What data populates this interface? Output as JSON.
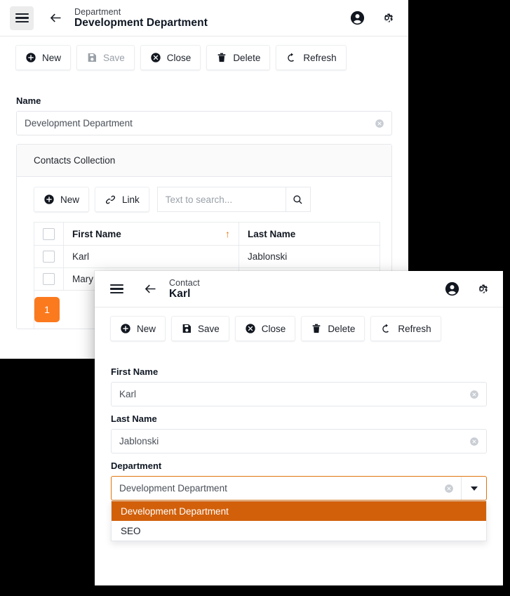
{
  "colors": {
    "accent_dark_orange": "#d2600a",
    "accent_orange": "#fb7a1e",
    "sort_orange": "#e8740c",
    "desktop_background": "#000000"
  },
  "window_department": {
    "appbar": {
      "menu_icon": "hamburger-menu-icon",
      "back_icon": "arrow-left-icon",
      "breadcrumb": "Department",
      "title": "Development Department",
      "account_icon": "account-circle-icon",
      "settings_icon": "gear-icon"
    },
    "toolbar": [
      {
        "label": "New",
        "icon": "plus-circle-icon",
        "disabled": false
      },
      {
        "label": "Save",
        "icon": "floppy-disk-icon",
        "disabled": true
      },
      {
        "label": "Close",
        "icon": "x-circle-icon",
        "disabled": false
      },
      {
        "label": "Delete",
        "icon": "trash-icon",
        "disabled": false
      },
      {
        "label": "Refresh",
        "icon": "refresh-icon",
        "disabled": false
      }
    ],
    "name_field": {
      "label": "Name",
      "value": "Development Department",
      "clear_icon": "clear-circle-icon"
    },
    "collection": {
      "header": "Contacts Collection",
      "new_label": "New",
      "new_icon": "plus-circle-icon",
      "link_label": "Link",
      "link_icon": "link-icon",
      "search_placeholder": "Text to search...",
      "search_value": "",
      "search_icon": "magnifier-icon",
      "columns": [
        "First Name",
        "Last Name"
      ],
      "sort_column": "First Name",
      "sort_direction": "asc",
      "sort_indicator": "↑",
      "rows": [
        {
          "first_name": "Karl",
          "last_name": "Jablonski",
          "checked": false
        },
        {
          "first_name": "Mary",
          "last_name": "",
          "checked": false
        }
      ],
      "pagination": {
        "current_page": "1"
      }
    }
  },
  "window_contact": {
    "appbar": {
      "menu_icon": "hamburger-menu-icon",
      "back_icon": "arrow-left-icon",
      "breadcrumb": "Contact",
      "title": "Karl",
      "account_icon": "account-circle-icon",
      "settings_icon": "gear-icon"
    },
    "toolbar": [
      {
        "label": "New",
        "icon": "plus-circle-icon",
        "disabled": false
      },
      {
        "label": "Save",
        "icon": "floppy-disk-icon",
        "disabled": false
      },
      {
        "label": "Close",
        "icon": "x-circle-icon",
        "disabled": false
      },
      {
        "label": "Delete",
        "icon": "trash-icon",
        "disabled": false
      },
      {
        "label": "Refresh",
        "icon": "refresh-icon",
        "disabled": false
      }
    ],
    "first_name": {
      "label": "First Name",
      "value": "Karl",
      "clear_icon": "clear-circle-icon"
    },
    "last_name": {
      "label": "Last Name",
      "value": "Jablonski",
      "clear_icon": "clear-circle-icon"
    },
    "department": {
      "label": "Department",
      "value": "Development Department",
      "clear_icon": "clear-circle-icon",
      "caret_icon": "chevron-down-icon",
      "expanded": true,
      "options": [
        {
          "label": "Development Department",
          "selected": true
        },
        {
          "label": "SEO",
          "selected": false
        }
      ]
    }
  }
}
